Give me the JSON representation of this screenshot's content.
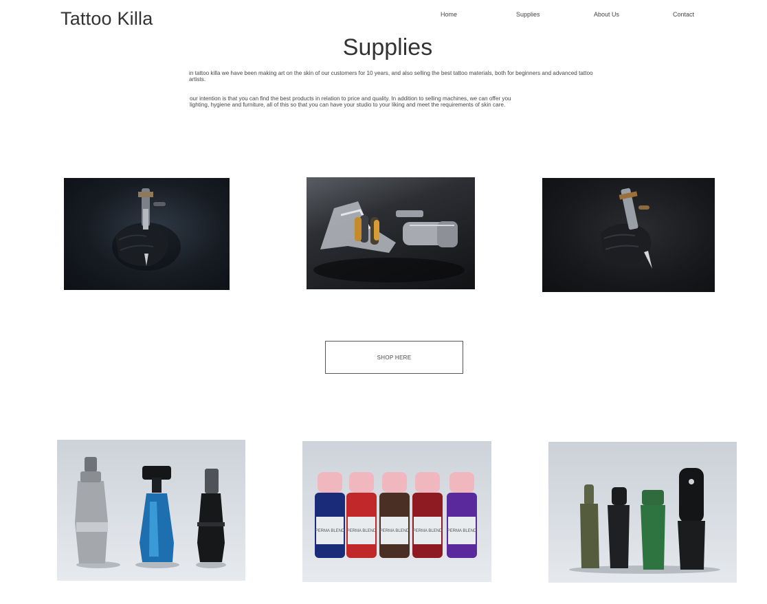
{
  "header": {
    "brand": "Tattoo Killa",
    "nav": {
      "home": "Home",
      "supplies": "Supplies",
      "about": "About Us",
      "contact": "Contact"
    }
  },
  "main": {
    "title": "Supplies",
    "intro_1": "in tattoo killa we have been making art on the skin of our customers for 10 years, and also selling the best tattoo materials, both for beginners and advanced tattoo artists.",
    "intro_2": "our intention is that you can find the best products in relation to price and quality. In addition to selling machines, we can offer you lighting, hygiene and furniture, all of this so that you can have your studio to your liking and meet the requirements of skin care.",
    "shop_button": "SHOP HERE"
  },
  "photos": {
    "row1": [
      "gloved-hand-holding-tattoo-machine",
      "chrome-coil-tattoo-machine",
      "gloved-hand-rotary-tattoo-machine"
    ],
    "row2": [
      "tattoo-grips",
      "perma-blend-ink-bottles",
      "rotary-pen-machines"
    ]
  },
  "ink_labels": [
    "PERMA BLEND",
    "PERMA BLEND",
    "PERMA BLEND",
    "PERMA BLEND",
    "PERMA BLEND"
  ]
}
